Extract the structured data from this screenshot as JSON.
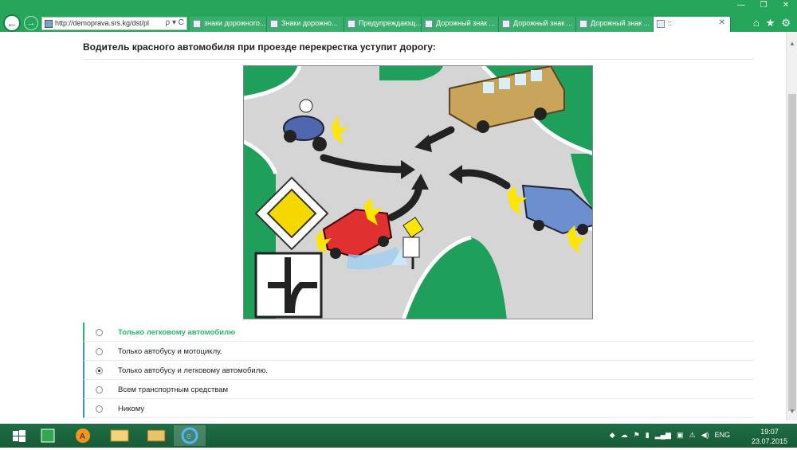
{
  "browser": {
    "url": "http://demoprava.srs.kg/dst/pl",
    "tabs": [
      "знаки дорожного...",
      "Знаки дорожно...",
      "Предупреждающ...",
      "Дорожный знак ...",
      "Дорожный знак ...",
      "Дорожный знак ...",
      "::"
    ],
    "window_controls": [
      "—",
      "❐",
      "✕"
    ],
    "toolbar_icons": [
      "⌂",
      "★",
      "⚙"
    ],
    "address_controls": "ρ ▾ C"
  },
  "question": "Водитель красного автомобиля при проезде перекрестка уступит дорогу:",
  "answers": [
    {
      "label": "Только легковому автомобилю",
      "selected": false,
      "correct": true
    },
    {
      "label": "Только автобусу и мотоциклу.",
      "selected": false,
      "correct": false
    },
    {
      "label": "Только автобусу и легковому автомобилю.",
      "selected": true,
      "correct": false
    },
    {
      "label": "Всем транспортным средствам",
      "selected": false,
      "correct": false
    },
    {
      "label": "Никому",
      "selected": false,
      "correct": false
    }
  ],
  "taskbar": {
    "language": "ENG",
    "time": "19:07",
    "date": "23.07.2015"
  },
  "colors": {
    "chrome": "#26a65b",
    "correct": "#27b86b",
    "answer_border": "#3b8fd0"
  }
}
